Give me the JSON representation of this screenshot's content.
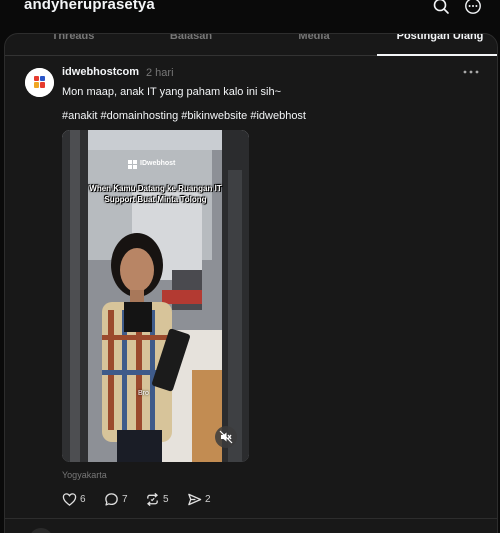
{
  "profile": {
    "username": "andyheruprasetya"
  },
  "top_icons": {
    "search": "search-icon",
    "more": "more-circle-icon"
  },
  "tabs": [
    {
      "label": "Threads",
      "active": false
    },
    {
      "label": "Balasan",
      "active": false
    },
    {
      "label": "Media",
      "active": false
    },
    {
      "label": "Postingan Ulang",
      "active": true
    }
  ],
  "post": {
    "author": "idwebhostcom",
    "time": "2 hari",
    "caption": "Mon maap, anak IT yang paham kalo ini sih~",
    "hashtags": "#anakit #domainhosting #bikinwebsite #idwebhost",
    "video": {
      "brand": "IDwebhost",
      "overlay_text": "When Kamu Datang ke Ruangan IT Support Buat Minta Tolong",
      "subtitle": "Bro",
      "muted": true
    },
    "location": "Yogyakarta",
    "stats": {
      "likes": "6",
      "replies": "7",
      "reposts": "5",
      "shares": "2"
    }
  },
  "colors": {
    "background": "#0a0a0a",
    "panel": "#181818",
    "text": "#f3f5f7",
    "muted": "#777777"
  }
}
